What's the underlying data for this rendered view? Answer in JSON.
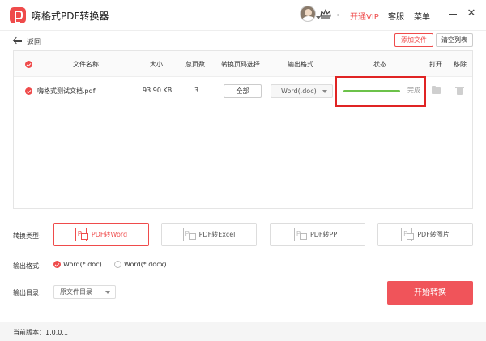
{
  "app": {
    "title": "嗨格式PDF转换器"
  },
  "header": {
    "vip": "开通VIP",
    "service": "客服",
    "menu": "菜单",
    "close": "✕"
  },
  "toolbar": {
    "back": "返回",
    "add_file": "添加文件",
    "clear_list": "清空列表"
  },
  "table": {
    "columns": [
      "文件名称",
      "大小",
      "总页数",
      "转换页码选择",
      "输出格式",
      "状态",
      "打开",
      "移除"
    ],
    "rows": [
      {
        "name": "嗨格式测试文档.pdf",
        "size": "93.90 KB",
        "pages": "3",
        "page_select": "全部",
        "format": "Word(.doc)",
        "status": "完成",
        "progress": 1.0
      }
    ]
  },
  "convert_type": {
    "label": "转换类型:",
    "options": [
      "PDF转Word",
      "PDF转Excel",
      "PDF转PPT",
      "PDF转图片"
    ],
    "selected": "PDF转Word"
  },
  "output_format": {
    "label": "输出格式:",
    "options": [
      "Word(*.doc)",
      "Word(*.docx)"
    ],
    "selected": "Word(*.doc)"
  },
  "output_dir": {
    "label": "输出目录:",
    "value": "原文件目录"
  },
  "start": {
    "label": "开始转换"
  },
  "status": {
    "version": "当前版本：1.0.0.1"
  },
  "colors": {
    "accent": "#ef4b4b",
    "progress": "#6cc24a",
    "highlight_box": "#e02424"
  }
}
